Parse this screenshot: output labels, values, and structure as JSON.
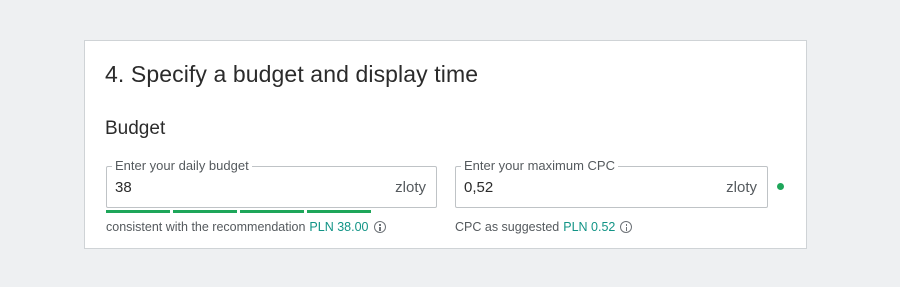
{
  "section": {
    "title": "4. Specify a budget and display time",
    "subtitle": "Budget"
  },
  "daily_budget": {
    "legend": "Enter your daily budget",
    "value": "38",
    "unit": "zloty",
    "strength_segments": 4,
    "hint_text": "consistent with the recommendation",
    "hint_amount": "PLN 38.00"
  },
  "max_cpc": {
    "legend": "Enter your maximum CPC",
    "value": "0,52",
    "unit": "zloty",
    "hint_text": "CPC as suggested",
    "hint_amount": "PLN 0.52"
  },
  "colors": {
    "accent": "#129486",
    "success": "#1ea65a"
  }
}
